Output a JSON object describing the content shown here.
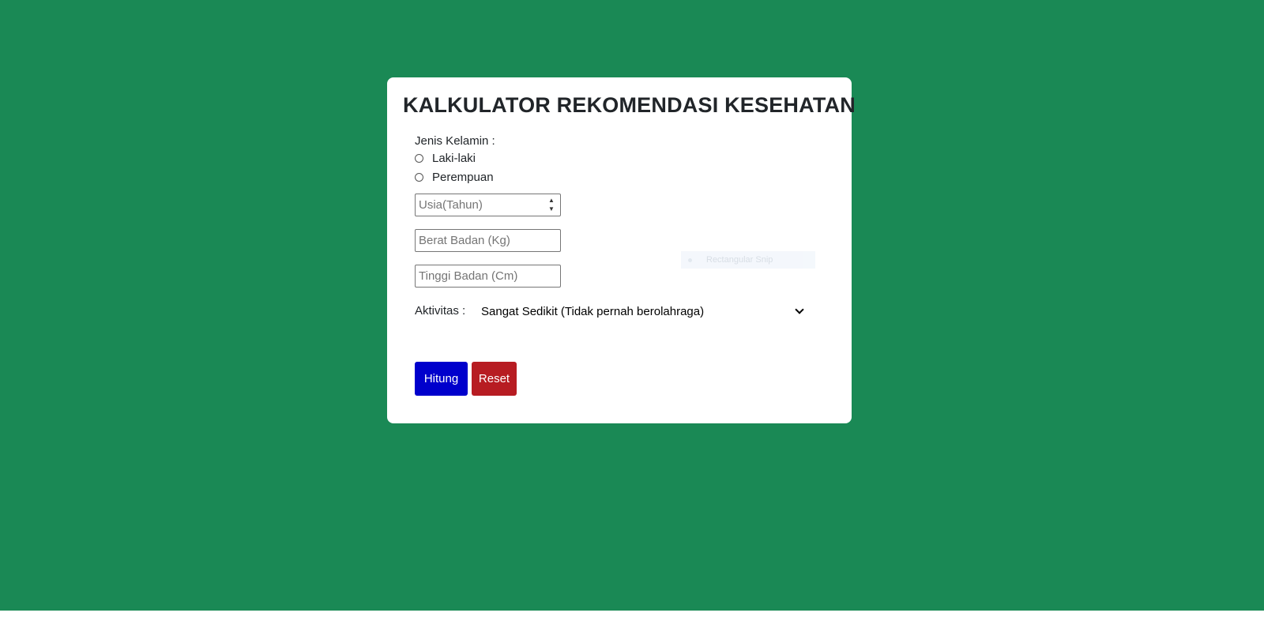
{
  "colors": {
    "background": "#1a8955",
    "card": "#ffffff",
    "hitung_button": "#0000cc",
    "reset_button": "#b71c22"
  },
  "form": {
    "title": "KALKULATOR REKOMENDASI KESEHATAN",
    "gender": {
      "label": "Jenis Kelamin :",
      "options": [
        "Laki-laki",
        "Perempuan"
      ],
      "selected": null
    },
    "age": {
      "placeholder": "Usia(Tahun)",
      "value": ""
    },
    "weight": {
      "placeholder": "Berat Badan (Kg)",
      "value": ""
    },
    "height": {
      "placeholder": "Tinggi Badan (Cm)",
      "value": ""
    },
    "activity": {
      "label": "Aktivitas :",
      "selected": "Sangat Sedikit (Tidak pernah berolahraga)"
    },
    "buttons": {
      "calculate": "Hitung",
      "reset": "Reset"
    }
  },
  "overlay": {
    "snip_label": "Rectangular Snip"
  }
}
